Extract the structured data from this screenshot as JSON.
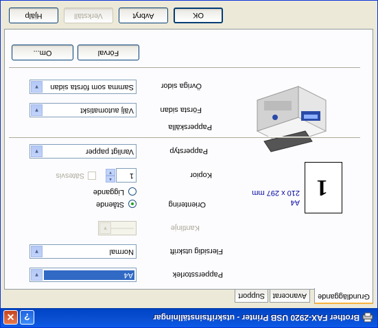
{
  "window": {
    "title": "Brother FAX-2920 USB Printer - utskriftsinställningar",
    "help_glyph": "?",
    "close_glyph": "✕"
  },
  "tabs": [
    {
      "label": "Grundläggande",
      "active": true
    },
    {
      "label": "Avancerat",
      "active": false
    },
    {
      "label": "Support",
      "active": false
    }
  ],
  "preview": {
    "glyph": "1",
    "paper_name": "A4",
    "paper_size": "210 x 297 mm"
  },
  "settings": {
    "paper_size": {
      "label": "Pappersstorlek",
      "value": "A4"
    },
    "multiple_page": {
      "label": "Flersidig utskrift",
      "value": "Normal"
    },
    "border_line": {
      "label": "Kantlinje",
      "value": "————"
    },
    "orientation": {
      "label": "Orientering",
      "portrait": "Stående",
      "landscape": "Liggande"
    },
    "copies": {
      "label": "Kopior",
      "value": "1",
      "collate": "Sätesvis"
    },
    "media_type": {
      "label": "Papperstyp",
      "value": "Vanligt papper"
    },
    "paper_source": {
      "label": "Papperskälla"
    },
    "first_page": {
      "label": "Första sidan",
      "value": "Välj automatiskt"
    },
    "other_pages": {
      "label": "Övriga sidor",
      "value": "Samma som första sidan"
    }
  },
  "panel_buttons": {
    "default": "Förval",
    "about": "Om..."
  },
  "dialog_buttons": {
    "ok": "OK",
    "cancel": "Avbryt",
    "apply": "Verkställ",
    "help": "Hjälp"
  },
  "colors": {
    "titlebar": "#0054e3",
    "window_bg": "#ece9d8",
    "selection": "#316ac5",
    "tab_highlight": "#f7b33e"
  }
}
